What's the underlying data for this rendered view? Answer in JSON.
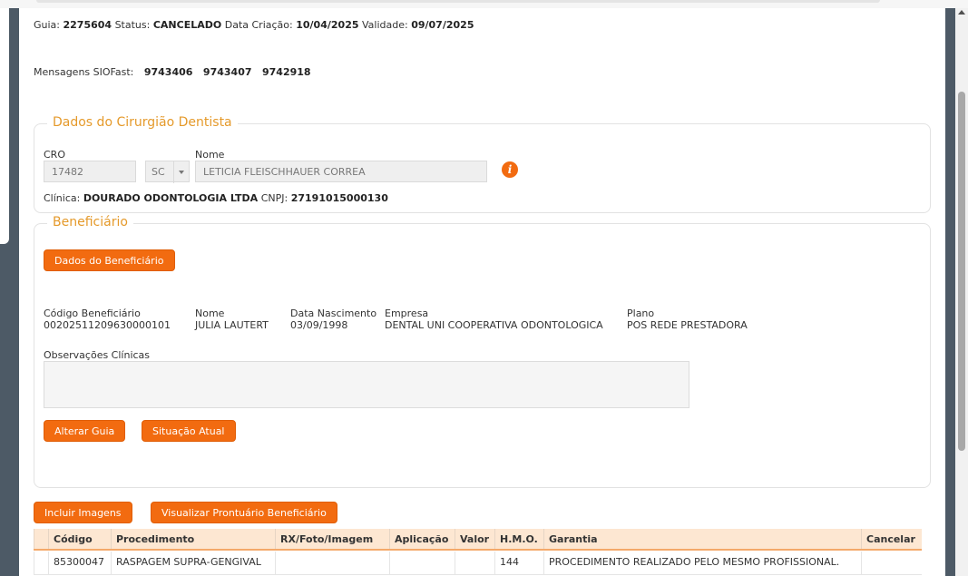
{
  "guide": {
    "guia_label": "Guia:",
    "guia_value": "2275604",
    "status_label": "Status:",
    "status_value": "CANCELADO",
    "created_label": "Data Criação:",
    "created_value": "10/04/2025",
    "validity_label": "Validade:",
    "validity_value": "09/07/2025"
  },
  "messages": {
    "label": "Mensagens SIOFast:",
    "items": [
      "9743406",
      "9743407",
      "9742918"
    ]
  },
  "dentist": {
    "legend": "Dados do Cirurgião Dentista",
    "cro_label": "CRO",
    "cro_value": "17482",
    "uf_value": "SC",
    "name_label": "Nome",
    "name_value": "LETICIA FLEISCHHAUER CORREA",
    "info_icon": "i",
    "clinic_label": "Clínica:",
    "clinic_value": "DOURADO ODONTOLOGIA LTDA",
    "cnpj_label": "CNPJ:",
    "cnpj_value": "27191015000130"
  },
  "beneficiary": {
    "legend": "Beneficiário",
    "details_button": "Dados do Beneficiário",
    "code_label": "Código Beneficiário",
    "code_value": "00202511209630000101",
    "name_label": "Nome",
    "name_value": "JULIA LAUTERT",
    "birth_label": "Data Nascimento",
    "birth_value": "03/09/1998",
    "company_label": "Empresa",
    "company_value": "DENTAL UNI COOPERATIVA ODONTOLOGICA",
    "plan_label": "Plano",
    "plan_value": "POS REDE PRESTADORA",
    "notes_label": "Observações Clínicas",
    "alter_button": "Alterar Guia",
    "status_button": "Situação Atual"
  },
  "actions": {
    "include_images": "Incluir Imagens",
    "view_record": "Visualizar Prontuário Beneficiário"
  },
  "table": {
    "headers": [
      "Código",
      "Procedimento",
      "RX/Foto/Imagem",
      "Aplicação",
      "Valor",
      "H.M.O.",
      "Garantia",
      "Cancelar"
    ],
    "rows": [
      [
        "85300047",
        "RASPAGEM SUPRA-GENGIVAL",
        "",
        "",
        "",
        "144",
        "PROCEDIMENTO REALIZADO PELO MESMO PROFISSIONAL.",
        ""
      ]
    ]
  },
  "colors": {
    "accent": "#f26b10",
    "legend": "#e59a2b",
    "sidebar": "#4d5a66"
  }
}
